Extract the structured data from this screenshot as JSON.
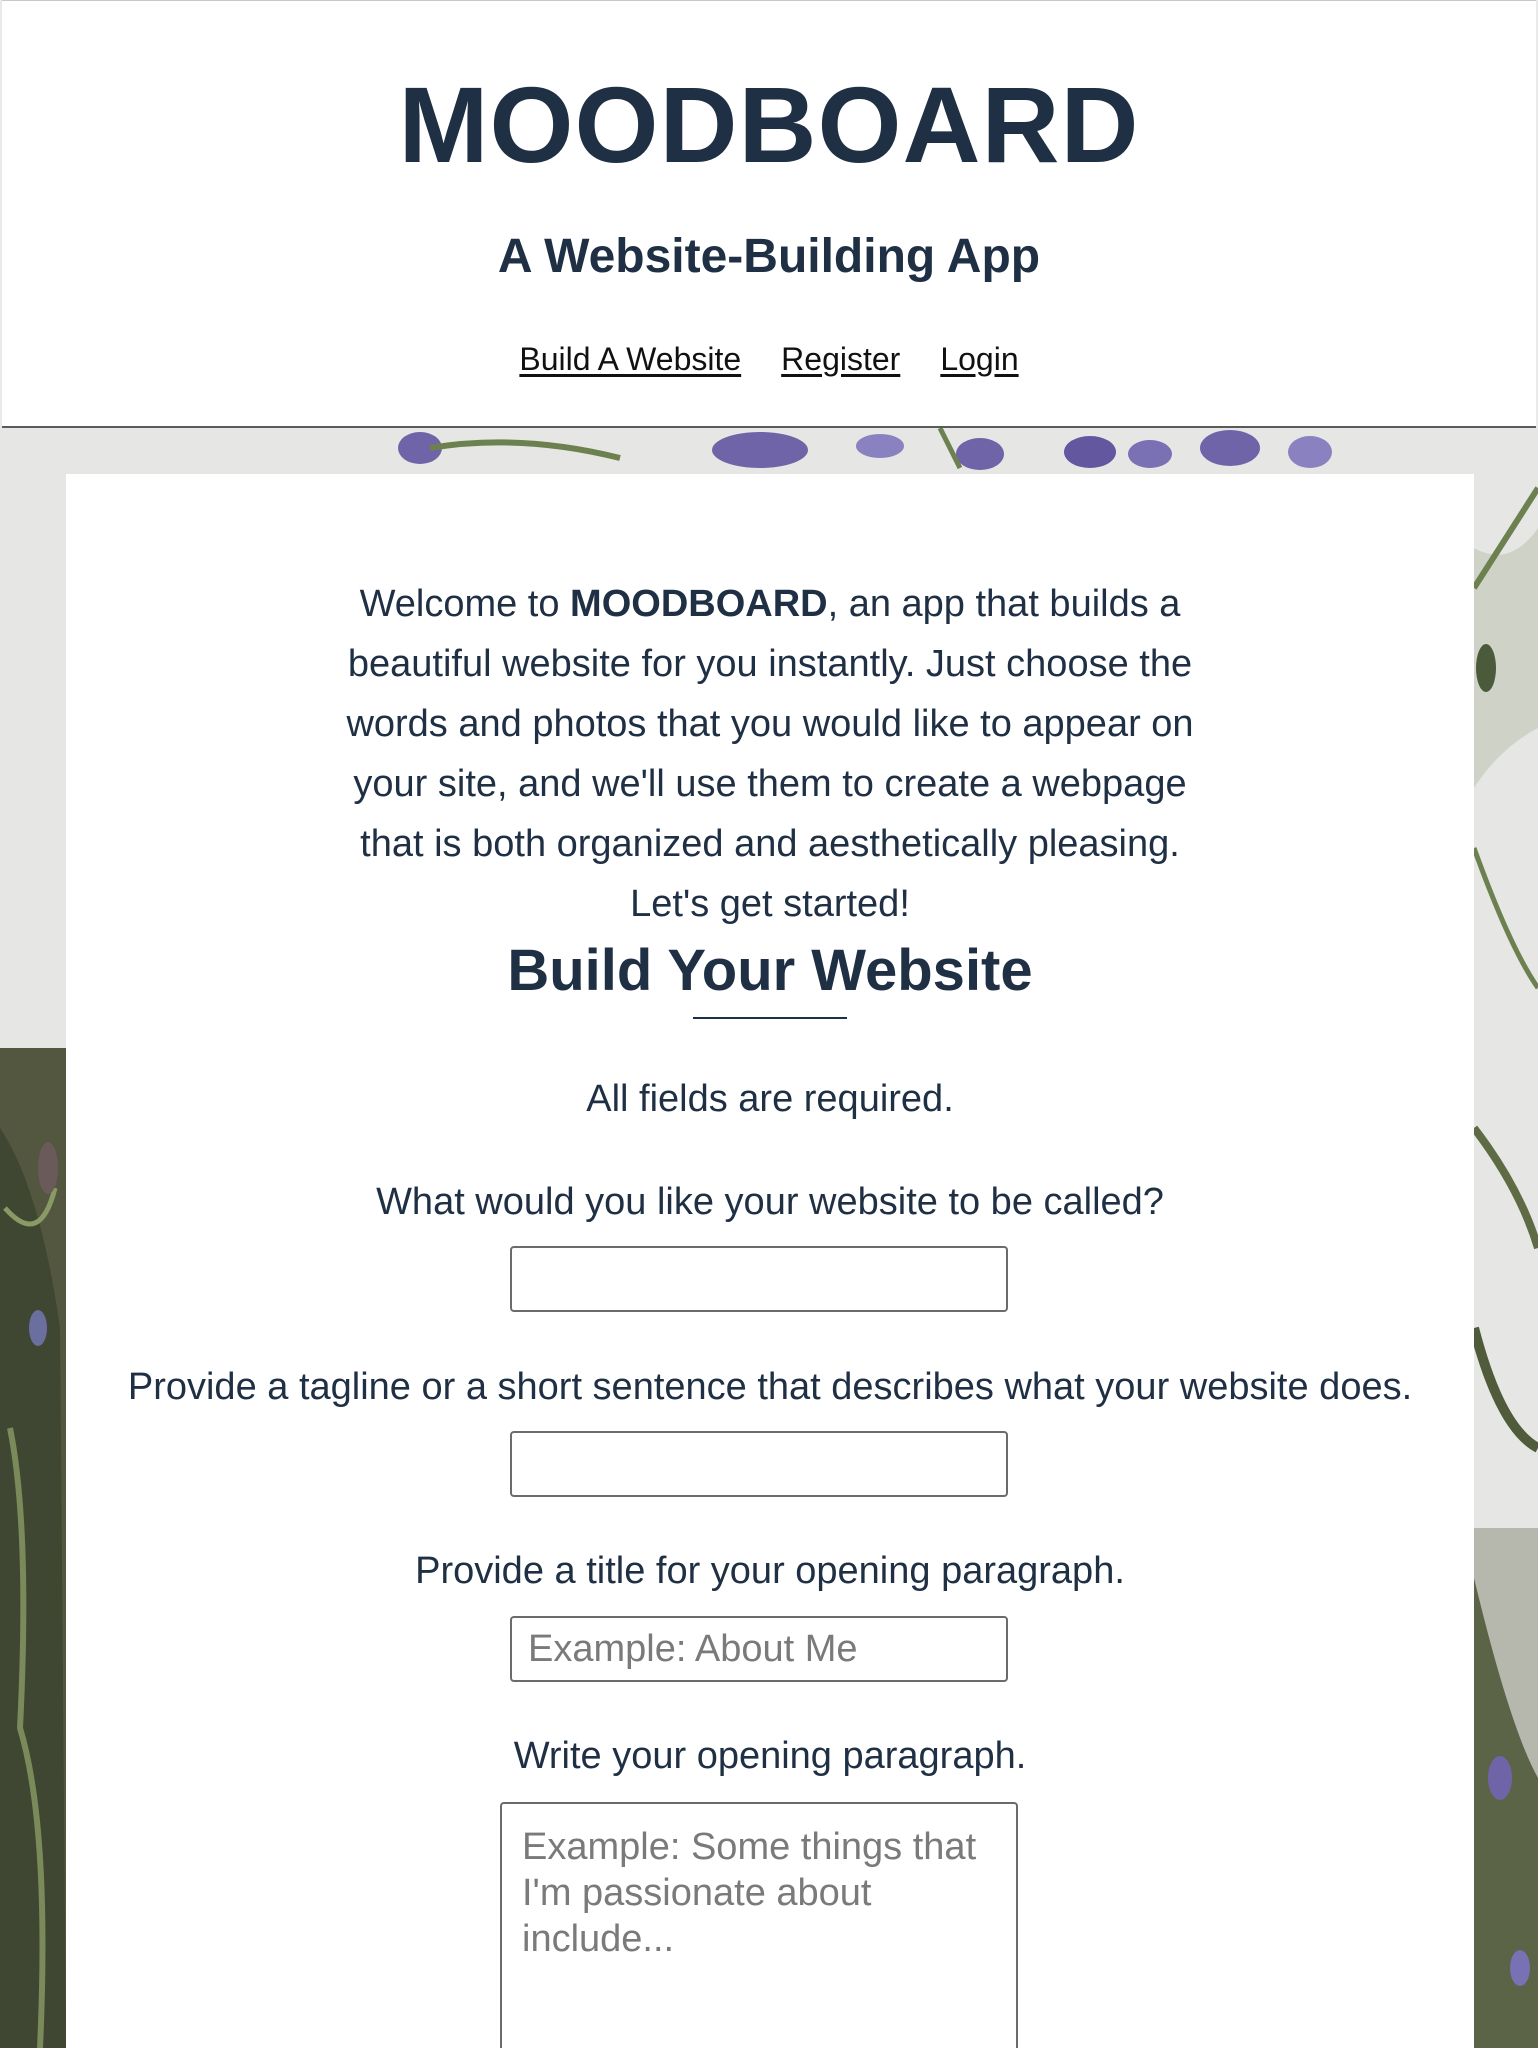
{
  "header": {
    "title": "MOODBOARD",
    "subtitle": "A Website-Building App",
    "nav": [
      {
        "label": "Build A Website"
      },
      {
        "label": "Register"
      },
      {
        "label": "Login"
      }
    ]
  },
  "intro": {
    "prefix": "Welcome to ",
    "brand": "MOODBOARD",
    "suffix": ", an app that builds a beautiful website for you instantly. Just choose the words and photos that you would like to appear on your site, and we'll use them to create a webpage that is both organized and aesthetically pleasing. Let's get started!"
  },
  "form": {
    "title": "Build Your Website",
    "required_note": "All fields are required.",
    "fields": [
      {
        "label": "What would you like your website to be called?",
        "value": "",
        "placeholder": ""
      },
      {
        "label": "Provide a tagline or a short sentence that describes what your website does.",
        "value": "",
        "placeholder": ""
      },
      {
        "label": "Provide a title for your opening paragraph.",
        "value": "",
        "placeholder": "Example: About Me"
      },
      {
        "label": "Write your opening paragraph.",
        "value": "",
        "placeholder": "Example: Some things that I'm passionate about include..."
      }
    ]
  },
  "colors": {
    "text": "#1f2f44",
    "background": "#e9e9e9",
    "card": "#ffffff",
    "foliage": "#5e6b45",
    "lavender": "#6f64a8"
  }
}
